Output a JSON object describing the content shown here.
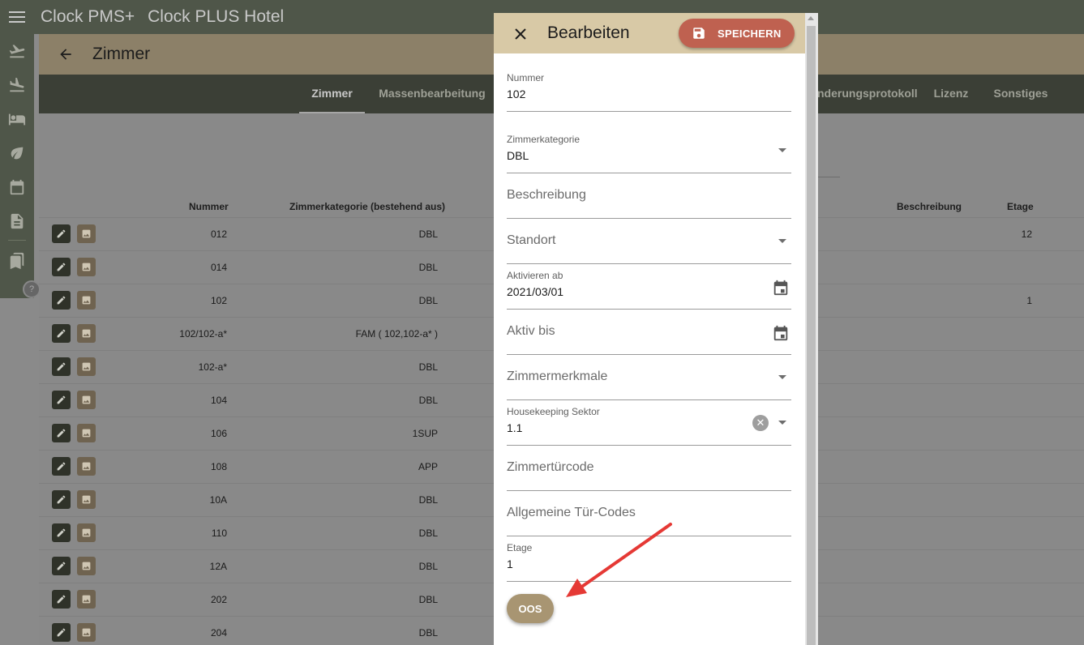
{
  "header": {
    "app_title": "Clock PMS+",
    "hotel_title": "Clock PLUS Hotel"
  },
  "page": {
    "title": "Zimmer"
  },
  "tabs": [
    {
      "label": "Zimmer"
    },
    {
      "label": "Massenbearbeitung"
    },
    {
      "label": "nderungsprotokoll"
    },
    {
      "label": "Lizenz"
    },
    {
      "label": "Sonstiges"
    }
  ],
  "table": {
    "headers": {
      "nummer": "Nummer",
      "kategorie": "Zimmerkategorie (bestehend aus)",
      "beschreibung": "Beschreibung",
      "etage": "Etage"
    },
    "rows": [
      {
        "nummer": "012",
        "kategorie": "DBL",
        "etage": "12"
      },
      {
        "nummer": "014",
        "kategorie": "DBL",
        "etage": ""
      },
      {
        "nummer": "102",
        "kategorie": "DBL",
        "etage": "1"
      },
      {
        "nummer": "102/102-a*",
        "kategorie": "FAM ( 102,102-a* )",
        "etage": ""
      },
      {
        "nummer": "102-a*",
        "kategorie": "DBL",
        "etage": ""
      },
      {
        "nummer": "104",
        "kategorie": "DBL",
        "etage": ""
      },
      {
        "nummer": "106",
        "kategorie": "1SUP",
        "etage": ""
      },
      {
        "nummer": "108",
        "kategorie": "APP",
        "etage": ""
      },
      {
        "nummer": "10A",
        "kategorie": "DBL",
        "etage": ""
      },
      {
        "nummer": "110",
        "kategorie": "DBL",
        "etage": ""
      },
      {
        "nummer": "12A",
        "kategorie": "DBL",
        "etage": ""
      },
      {
        "nummer": "202",
        "kategorie": "DBL",
        "etage": ""
      },
      {
        "nummer": "204",
        "kategorie": "DBL",
        "etage": ""
      }
    ]
  },
  "dialog": {
    "title": "Bearbeiten",
    "save_label": "SPEICHERN",
    "oos_label": "OOS",
    "fields": {
      "nummer": {
        "label": "Nummer",
        "value": "102"
      },
      "zimmerkategorie": {
        "label": "Zimmerkategorie",
        "value": "DBL"
      },
      "beschreibung": {
        "placeholder": "Beschreibung"
      },
      "standort": {
        "placeholder": "Standort"
      },
      "aktivieren_ab": {
        "label": "Aktivieren ab",
        "value": "2021/03/01"
      },
      "aktiv_bis": {
        "placeholder": "Aktiv bis"
      },
      "zimmermerkmale": {
        "placeholder": "Zimmermerkmale"
      },
      "housekeeping": {
        "label": "Housekeeping Sektor",
        "value": "1.1"
      },
      "tuercode": {
        "placeholder": "Zimmertürcode"
      },
      "allg_tuercodes": {
        "placeholder": "Allgemeine Tür-Codes"
      },
      "etage": {
        "label": "Etage",
        "value": "1"
      }
    }
  },
  "icons": {
    "menu": "hamburger-icon",
    "back": "arrow-left-icon",
    "close": "close-icon",
    "save": "floppy-icon",
    "calendar": "calendar-icon",
    "clear": "clear-circle-icon",
    "edit": "pencil-icon",
    "image": "image-icon",
    "help": "help-icon"
  },
  "colors": {
    "topbar": "#4f5649",
    "page_header": "#8c8068",
    "tabs_bar": "#3b3f36",
    "dialog_header": "#d8c9a6",
    "save_button": "#bf6150",
    "oos_button": "#a89572",
    "annotation_arrow": "#e53935"
  }
}
